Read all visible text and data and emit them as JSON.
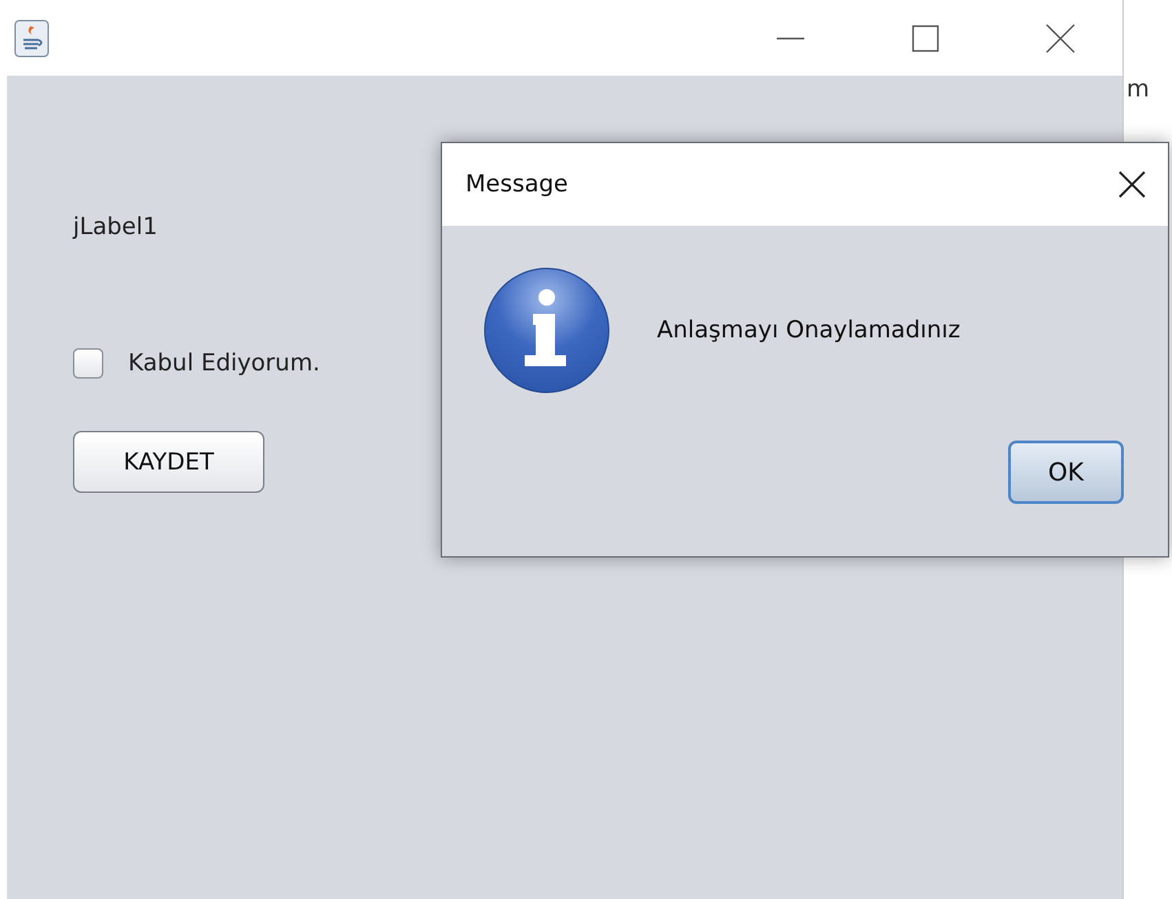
{
  "main_window": {
    "label": "jLabel1",
    "checkbox": {
      "label": "Kabul Ediyorum.",
      "checked": false
    },
    "button": "KAYDET"
  },
  "background_window": {
    "text": "m"
  },
  "dialog": {
    "title": "Message",
    "kind": "information",
    "message": "Anlaşmayı Onaylamadınız",
    "buttons": [
      "OK"
    ]
  }
}
